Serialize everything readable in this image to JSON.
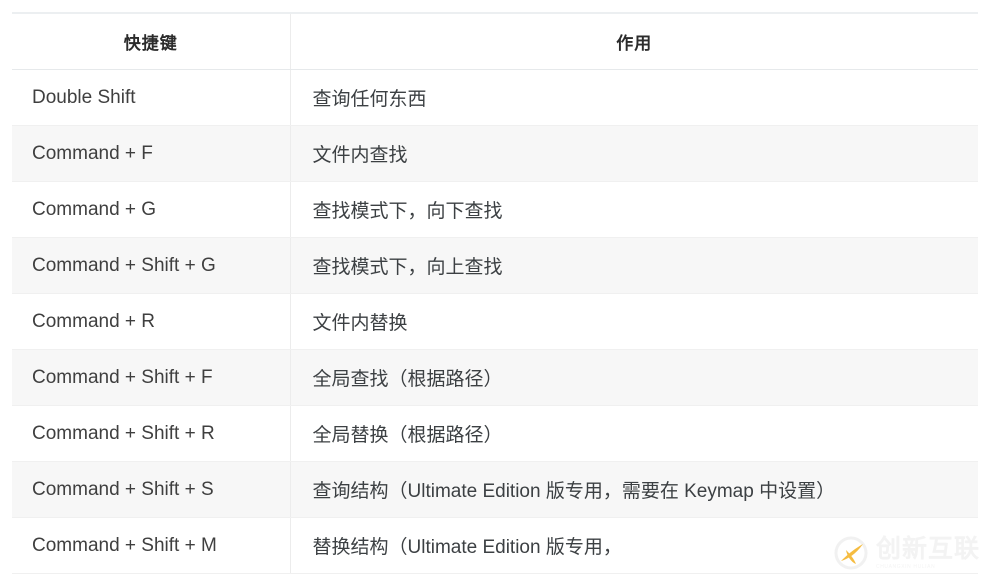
{
  "table": {
    "headers": {
      "key_column": "快捷键",
      "description_column": "作用"
    },
    "rows": [
      {
        "key": "Double Shift",
        "desc": "查询任何东西"
      },
      {
        "key": "Command + F",
        "desc": "文件内查找"
      },
      {
        "key": "Command + G",
        "desc": "查找模式下，向下查找"
      },
      {
        "key": "Command + Shift + G",
        "desc": "查找模式下，向上查找"
      },
      {
        "key": "Command + R",
        "desc": "文件内替换"
      },
      {
        "key": "Command + Shift + F",
        "desc": "全局查找（根据路径）"
      },
      {
        "key": "Command + Shift + R",
        "desc": "全局替换（根据路径）"
      },
      {
        "key": "Command + Shift + S",
        "desc": "查询结构（Ultimate Edition 版专用，需要在 Keymap 中设置）"
      },
      {
        "key": "Command + Shift + M",
        "desc": "替换结构（Ultimate Edition 版专用，"
      }
    ]
  },
  "watermark": {
    "brand": "创新互联",
    "tagline": "CHUANGXIN HULIAN",
    "logo_letter": "C",
    "accent_color": "#f5b731",
    "text_color": "#f2f2f2"
  },
  "colors": {
    "row_alt_background": "#f7f7f7",
    "row_background": "#ffffff",
    "border": "#f0f0f0",
    "header_text": "#2b2b2b",
    "body_text": "#3c4043"
  }
}
